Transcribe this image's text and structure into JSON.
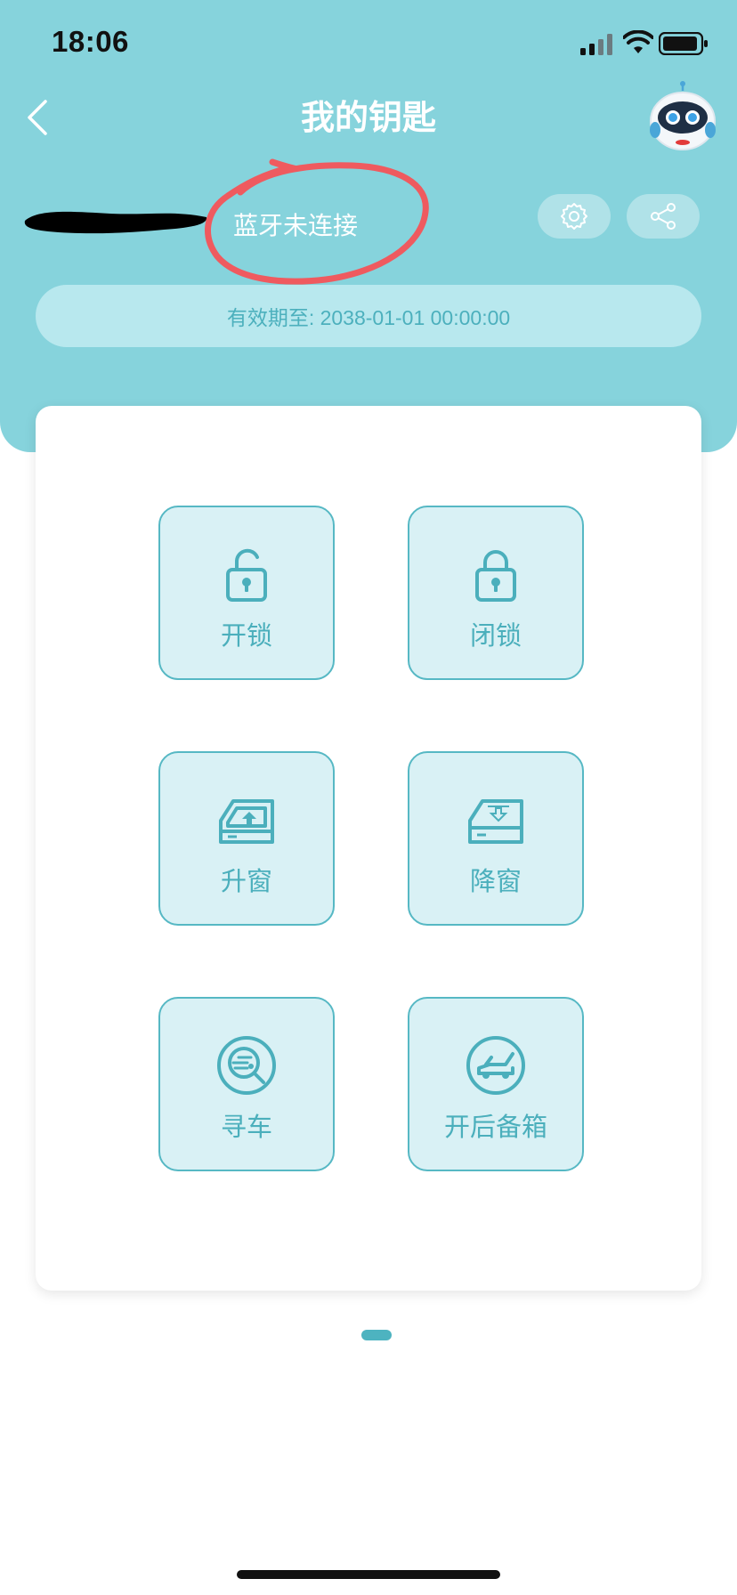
{
  "status_bar": {
    "time": "18:06"
  },
  "header": {
    "title": "我的钥匙",
    "back_icon": "chevron-left-icon",
    "avatar_icon": "robot-assistant-icon"
  },
  "key_info": {
    "bluetooth_status": "蓝牙未连接",
    "settings_icon": "gear-icon",
    "share_icon": "share-icon",
    "validity": "有效期至: 2038-01-01 00:00:00"
  },
  "controls": [
    {
      "label": "开锁",
      "icon": "unlock-icon"
    },
    {
      "label": "闭锁",
      "icon": "lock-icon"
    },
    {
      "label": "升窗",
      "icon": "window-up-icon"
    },
    {
      "label": "降窗",
      "icon": "window-down-icon"
    },
    {
      "label": "寻车",
      "icon": "find-car-icon"
    },
    {
      "label": "开后备箱",
      "icon": "trunk-open-icon"
    }
  ],
  "pager": {
    "current_page": 1,
    "total_pages": 1
  },
  "colors": {
    "header_bg": "#86d3dc",
    "accent": "#4bafbc",
    "button_bg": "#d9f1f5",
    "annotation": "#ef5a5f"
  }
}
